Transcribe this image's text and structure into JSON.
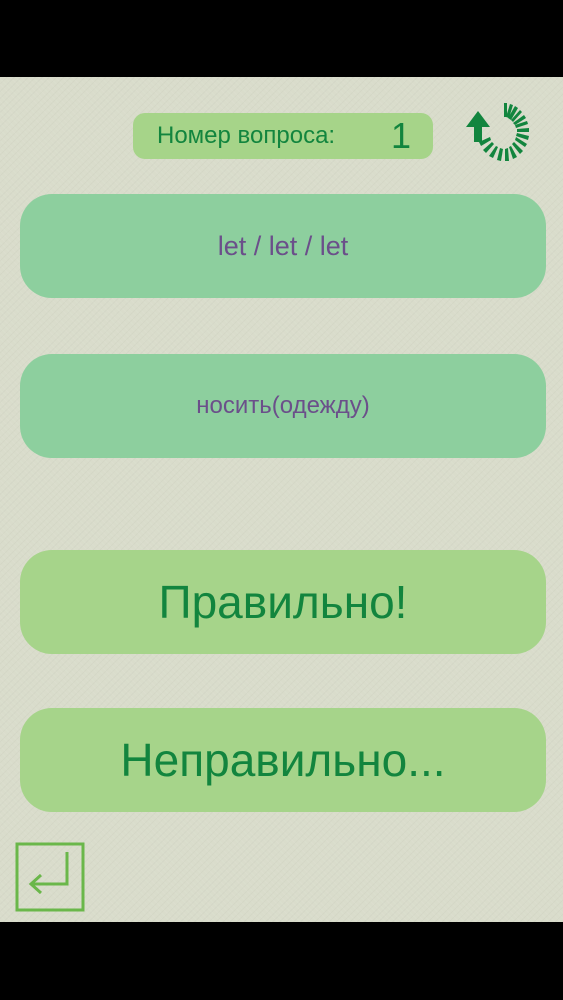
{
  "header": {
    "counter_label": "Номер вопроса:",
    "counter_value": "1",
    "restart_icon": "circular-arrow-restart-icon"
  },
  "cards": {
    "word": "let / let / let",
    "translation": "носить(одежду)"
  },
  "answers": {
    "correct_label": "Правильно!",
    "wrong_label": "Неправильно..."
  },
  "footer": {
    "back_icon": "return-arrow-icon"
  },
  "colors": {
    "background": "#d9dccb",
    "accent_green": "#12853e",
    "card_teal": "#8dcf9e",
    "card_light_green": "#a6d48a",
    "word_text": "#6b4f8a"
  }
}
